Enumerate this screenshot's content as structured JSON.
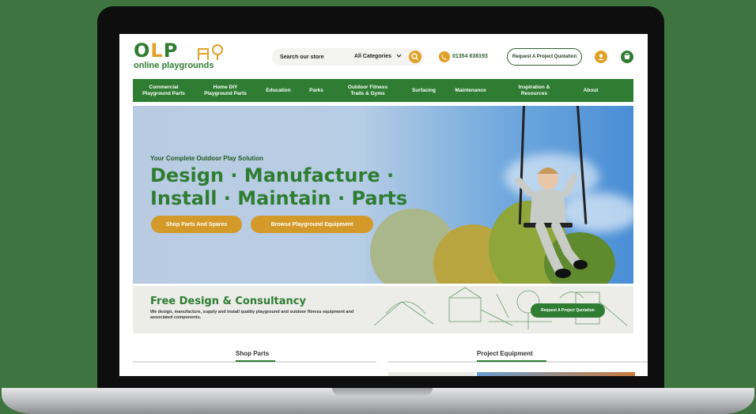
{
  "brand": {
    "logo_mark": "OLP",
    "logo_sub": "online playgrounds"
  },
  "header": {
    "search_placeholder": "Search our store",
    "category_label": "All Categories",
    "phone": "01354 638193",
    "quote_label": "Request A Project Quotation"
  },
  "nav": {
    "items": [
      {
        "label": "Commercial\nPlayground Parts"
      },
      {
        "label": "Home DIY\nPlayground Parts"
      },
      {
        "label": "Education"
      },
      {
        "label": "Parks"
      },
      {
        "label": "Outdoor Fitness\nTrails & Gyms"
      },
      {
        "label": "Surfacing"
      },
      {
        "label": "Maintenance"
      },
      {
        "label": "Inspiration &\nResources"
      },
      {
        "label": "About"
      }
    ]
  },
  "hero": {
    "tagline": "Your Complete Outdoor Play Solution",
    "title_line1": "Design · Manufacture ·",
    "title_line2": "Install · Maintain · Parts",
    "btn_shop": "Shop Parts And Spares",
    "btn_browse": "Browse Playground Equipment"
  },
  "consultancy": {
    "title": "Free Design & Consultancy",
    "description": "We design, manufacture, supply and install quality playground and outdoor fitness equipment and associated components.",
    "button": "Request A Project Quotation"
  },
  "sections": {
    "shop_parts": "Shop Parts",
    "project_equipment": "Project Equipment"
  },
  "colors": {
    "brand_green": "#2e7d32",
    "accent_gold": "#e0a126",
    "background": "#3e7440"
  }
}
